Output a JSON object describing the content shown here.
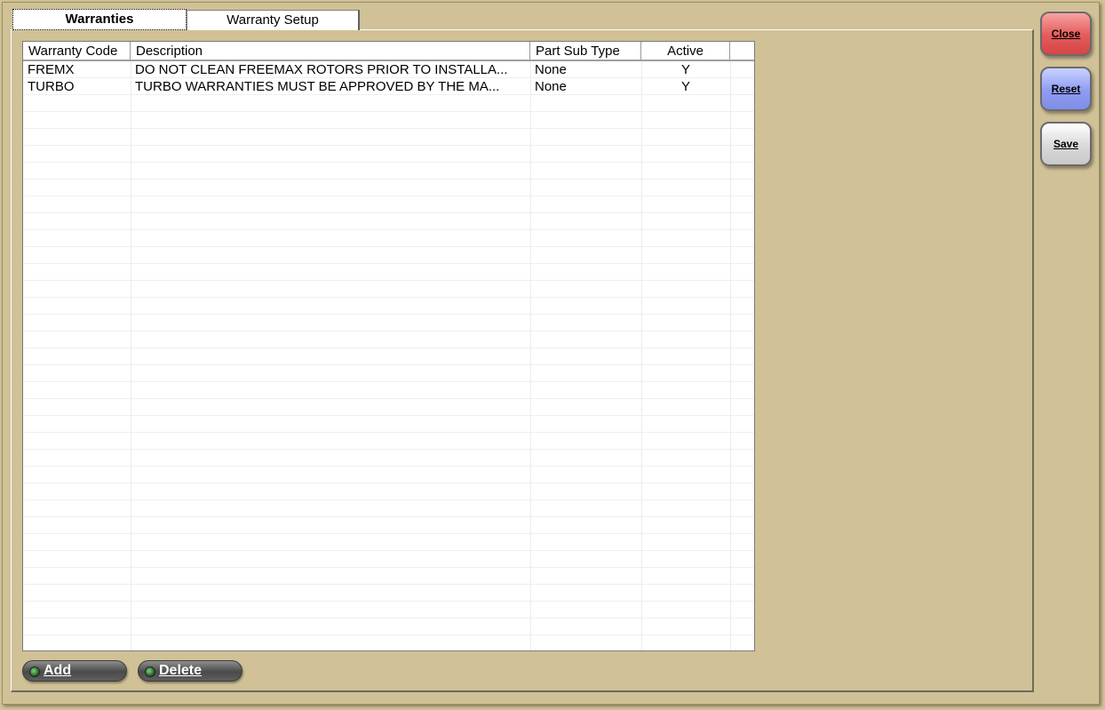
{
  "tabs": {
    "warranties": "Warranties",
    "setup": "Warranty Setup"
  },
  "grid": {
    "headers": {
      "code": "Warranty Code",
      "description": "Description",
      "part_sub_type": "Part Sub Type",
      "active": "Active"
    },
    "rows": [
      {
        "code": "FREMX",
        "description": "DO NOT CLEAN FREEMAX ROTORS PRIOR TO INSTALLA...",
        "part_sub_type": "None",
        "active": "Y"
      },
      {
        "code": "TURBO",
        "description": "TURBO WARRANTIES MUST BE APPROVED BY THE MA...",
        "part_sub_type": "None",
        "active": "Y"
      }
    ]
  },
  "actions": {
    "add": "Add",
    "delete": "Delete"
  },
  "side_buttons": {
    "close": "Close",
    "reset": "Reset",
    "save": "Save"
  },
  "colors": {
    "background": "#d0c196",
    "close": "#e45a5a",
    "reset": "#8e9cf2",
    "save": "#d9d9d9",
    "indicator": "#2e8b2e"
  }
}
